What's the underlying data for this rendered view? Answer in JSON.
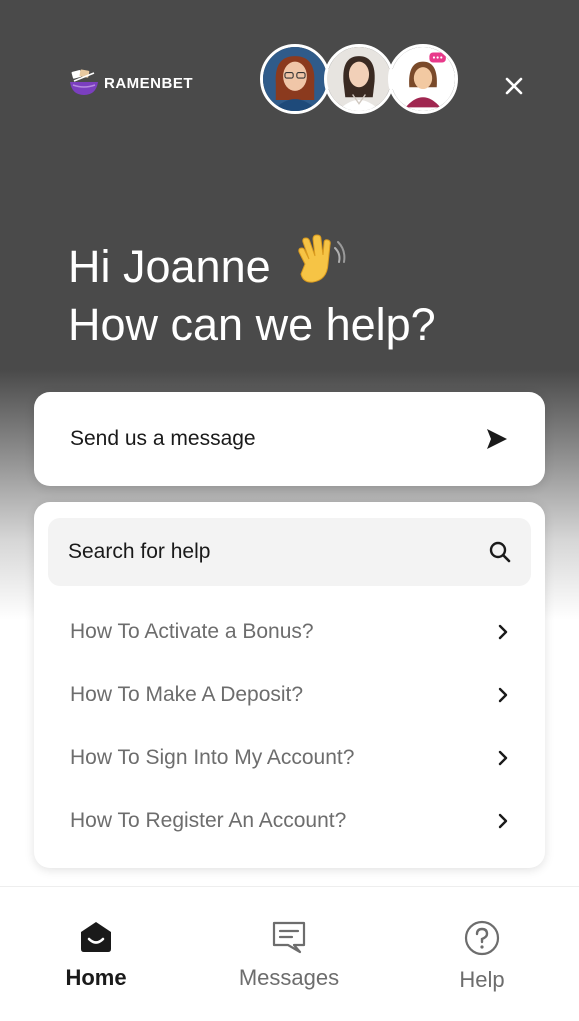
{
  "brand": {
    "name": "RAMENBET",
    "logo_icon": "ramen-bowl-icon",
    "accent": "#7b3fbf"
  },
  "header": {
    "avatars": [
      "agent-avatar-1",
      "agent-avatar-2",
      "agent-avatar-3"
    ],
    "close_icon": "close-icon"
  },
  "greeting": {
    "line1": "Hi Joanne",
    "line2": "How can we help?",
    "emoji": "waving-hand-icon"
  },
  "message_card": {
    "label": "Send us a message",
    "icon": "send-icon"
  },
  "help": {
    "search_label": "Search for help",
    "search_icon": "search-icon",
    "faqs": [
      {
        "label": "How To Activate a Bonus?"
      },
      {
        "label": "How To Make A Deposit?"
      },
      {
        "label": "How To Sign Into My Account?"
      },
      {
        "label": "How To Register An Account?"
      }
    ]
  },
  "nav": {
    "home": {
      "label": "Home",
      "icon": "home-icon"
    },
    "messages": {
      "label": "Messages",
      "icon": "messages-icon"
    },
    "help": {
      "label": "Help",
      "icon": "help-icon"
    }
  }
}
